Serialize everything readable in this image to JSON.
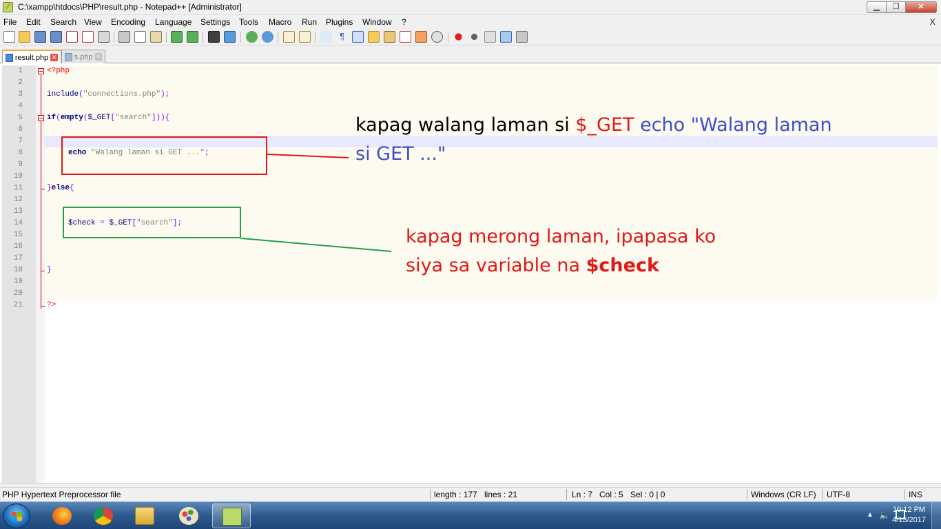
{
  "window": {
    "title": "C:\\xampp\\htdocs\\PHP\\result.php - Notepad++ [Administrator]",
    "minimize_label": "▁",
    "maximize_label": "❐",
    "close_label": "✕"
  },
  "menu": {
    "items": [
      "File",
      "Edit",
      "Search",
      "View",
      "Encoding",
      "Language",
      "Settings",
      "Tools",
      "Macro",
      "Run",
      "Plugins",
      "Window",
      "?"
    ],
    "close_doc": "X"
  },
  "tabs": [
    {
      "label": "result.php",
      "active": true
    },
    {
      "label": "s.php",
      "active": false
    }
  ],
  "editor": {
    "line_numbers": [
      "1",
      "2",
      "3",
      "4",
      "5",
      "6",
      "7",
      "8",
      "9",
      "10",
      "11",
      "12",
      "13",
      "14",
      "15",
      "16",
      "17",
      "18",
      "19",
      "20",
      "21"
    ],
    "caret_line": 7
  },
  "annotations": {
    "red_note": {
      "line1_part1": "kapag walang laman si ",
      "line1_part2": "$_GET",
      "line1_part3": " echo \"Walang laman",
      "line2": "si GET ...\""
    },
    "green_note": {
      "line1": "kapag merong laman, ipapasa ko",
      "line2_part1": "siya sa variable na ",
      "line2_part2": "$check"
    }
  },
  "statusbar": {
    "file_type": "PHP Hypertext Preprocessor file",
    "length": "length : 177",
    "lines": "lines : 21",
    "ln": "Ln : 7",
    "col": "Col : 5",
    "sel": "Sel : 0 | 0",
    "eol": "Windows (CR LF)",
    "encoding": "UTF-8",
    "mode": "INS"
  },
  "taskbar": {
    "time": "10:12 PM",
    "date": "4/13/2017"
  },
  "colors": {
    "annotation_red": "#e01818",
    "annotation_green": "#22a04a",
    "annotation_blue": "#3c4fc8",
    "caret_line": "#e8e8ff"
  }
}
